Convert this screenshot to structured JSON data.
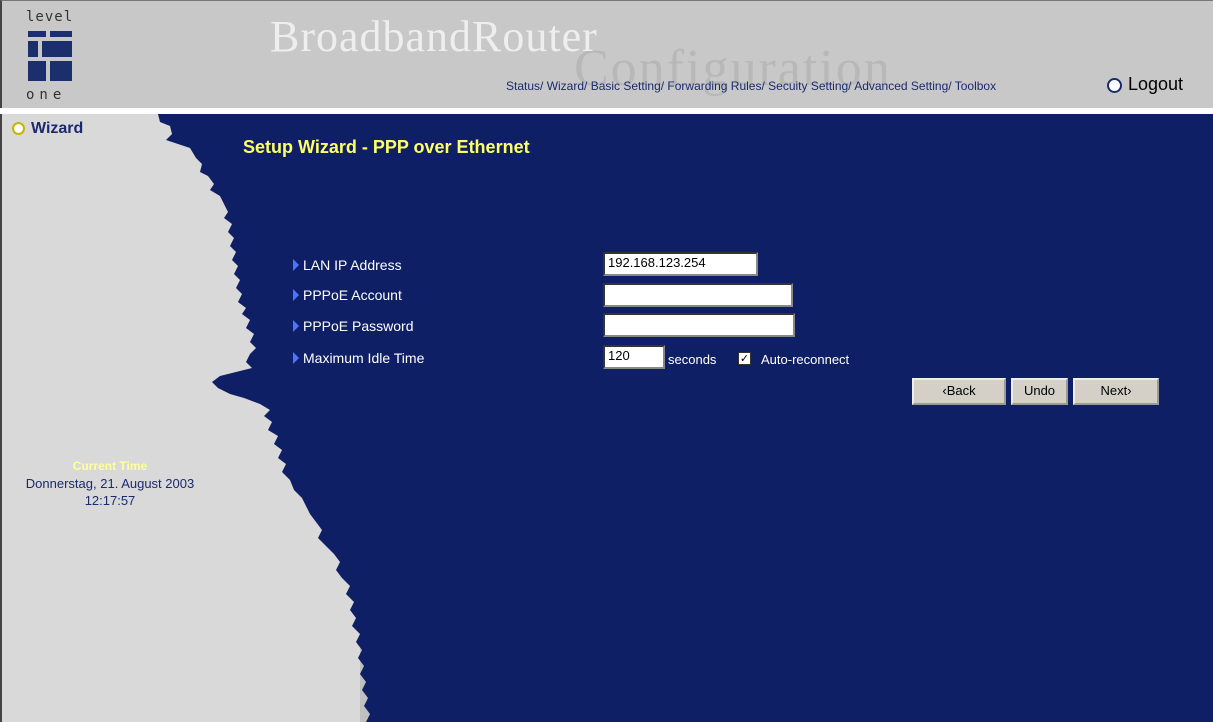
{
  "logo": {
    "top": "level",
    "bottom": "one"
  },
  "brand": {
    "title": "BroadbandRouter",
    "subtitle": "Configuration"
  },
  "nav": {
    "items": [
      "Status/",
      "Wizard/",
      "Basic Setting/",
      "Forwarding Rules/",
      "Secuity Setting/",
      "Advanced Setting/",
      "Toolbox"
    ],
    "logout": "Logout"
  },
  "sidebar": {
    "wizard": "Wizard",
    "current_time_label": "Current Time",
    "date": "Donnerstag, 21. August 2003",
    "time": "12:17:57"
  },
  "main": {
    "title": "Setup Wizard - PPP over Ethernet",
    "fields": {
      "lan_ip": {
        "label": "LAN IP Address",
        "value": "192.168.123.254"
      },
      "pppoe_account": {
        "label": "PPPoE Account",
        "value": ""
      },
      "pppoe_password": {
        "label": "PPPoE Password",
        "value": ""
      },
      "idle_time": {
        "label": "Maximum Idle Time",
        "value": "120",
        "unit": "seconds"
      }
    },
    "auto_reconnect": {
      "label": "Auto-reconnect",
      "checked": true
    },
    "buttons": {
      "back": "‹Back",
      "undo": "Undo",
      "next": "Next›"
    }
  },
  "colors": {
    "main_bg": "#0f1f66",
    "sidebar_bg": "#d9d9d9",
    "title": "#ffff66"
  }
}
